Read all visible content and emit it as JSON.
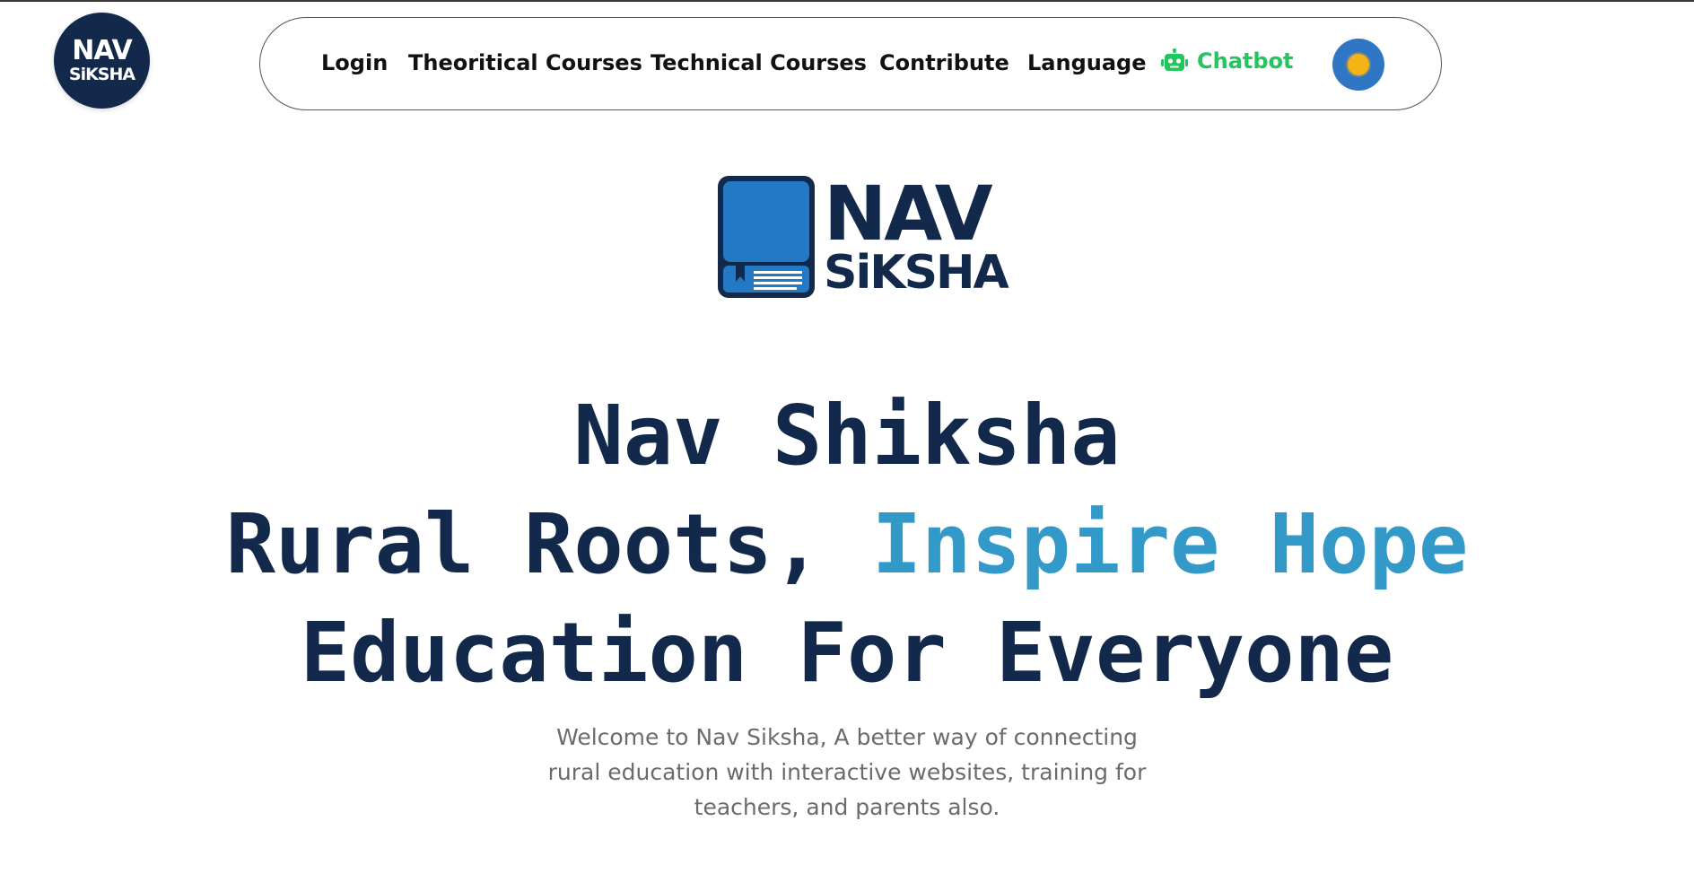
{
  "brand": {
    "corner_logo_line1": "NAV",
    "corner_logo_line2": "SiKSHA",
    "main_logo_line1": "NAV",
    "main_logo_line2": "SiKSHA"
  },
  "nav": {
    "login": "Login",
    "theoretical_courses": "Theoritical Courses",
    "technical_courses": "Technical Courses",
    "contribute": "Contribute",
    "language": "Language",
    "chatbot": "Chatbot",
    "chatbot_icon": "robot-icon",
    "theme_toggle_icon": "sun-icon"
  },
  "hero": {
    "line1": "Nav Shiksha",
    "line2_part1": "Rural Roots, ",
    "line2_accent": "Inspire Hope",
    "line3": "Education For Everyone",
    "subtitle": "Welcome to Nav Siksha, A better way of connecting rural education with interactive websites, training for teachers, and parents also."
  },
  "colors": {
    "navy": "#13294b",
    "accent": "#3399c8",
    "chatbot_green": "#22c55e",
    "toggle_blue": "#2f76c4",
    "sun_yellow": "#f6b318"
  }
}
